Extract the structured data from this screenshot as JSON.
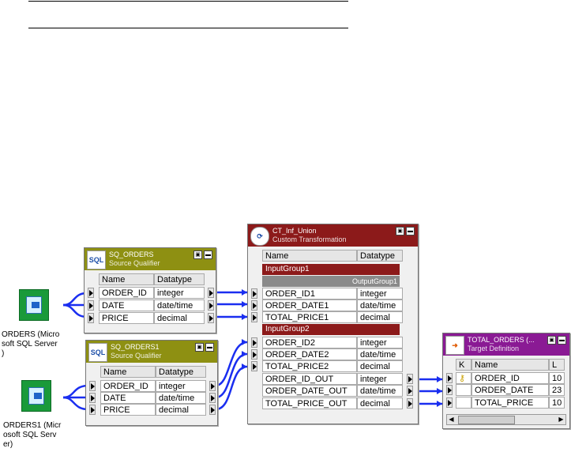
{
  "sources": [
    {
      "label_lines": [
        "ORDERS (Micro",
        "soft SQL Server",
        ")"
      ]
    },
    {
      "label_lines": [
        "ORDERS1 (Micr",
        "osoft SQL Serv",
        "er)"
      ]
    }
  ],
  "sq_orders": {
    "title": "SQ_ORDERS",
    "subtitle": "Source Qualifier",
    "icon_text": "SQL",
    "col_name": "Name",
    "col_type": "Datatype",
    "rows": [
      {
        "name": "ORDER_ID",
        "type": "integer"
      },
      {
        "name": "DATE",
        "type": "date/time"
      },
      {
        "name": "PRICE",
        "type": "decimal"
      }
    ]
  },
  "sq_orders1": {
    "title": "SQ_ORDERS1",
    "subtitle": "Source Qualifier",
    "icon_text": "SQL",
    "col_name": "Name",
    "col_type": "Datatype",
    "rows": [
      {
        "name": "ORDER_ID",
        "type": "integer"
      },
      {
        "name": "DATE",
        "type": "date/time"
      },
      {
        "name": "PRICE",
        "type": "decimal"
      }
    ]
  },
  "ct_union": {
    "title": "CT_Inf_Union",
    "subtitle": "Custom Transformation",
    "col_name": "Name",
    "col_type": "Datatype",
    "input_group1": "InputGroup1",
    "output_group1": "OutputGroup1",
    "group1_rows": [
      {
        "name": "ORDER_ID1",
        "type": "integer"
      },
      {
        "name": "ORDER_DATE1",
        "type": "date/time"
      },
      {
        "name": "TOTAL_PRICE1",
        "type": "decimal"
      }
    ],
    "input_group2": "InputGroup2",
    "group2_rows": [
      {
        "name": "ORDER_ID2",
        "type": "integer"
      },
      {
        "name": "ORDER_DATE2",
        "type": "date/time"
      },
      {
        "name": "TOTAL_PRICE2",
        "type": "decimal"
      }
    ],
    "out_rows": [
      {
        "name": "ORDER_ID_OUT",
        "type": "integer"
      },
      {
        "name": "ORDER_DATE_OUT",
        "type": "date/time"
      },
      {
        "name": "TOTAL_PRICE_OUT",
        "type": "decimal"
      }
    ]
  },
  "target": {
    "title": "TOTAL_ORDERS (...",
    "subtitle": "Target Definition",
    "col_k": "K",
    "col_name": "Name",
    "col_l": "L",
    "rows": [
      {
        "name": "ORDER_ID",
        "l": "10"
      },
      {
        "name": "ORDER_DATE",
        "l": "23"
      },
      {
        "name": "TOTAL_PRICE",
        "l": "10"
      }
    ]
  },
  "colors": {
    "qualifier_header": "#8e9012",
    "custom_header": "#8c1a1a",
    "group_bar": "#8c1a1a",
    "target_header": "#8a1a94",
    "link_blue": "#1a2ef0",
    "source_green": "#1a9a3a"
  }
}
